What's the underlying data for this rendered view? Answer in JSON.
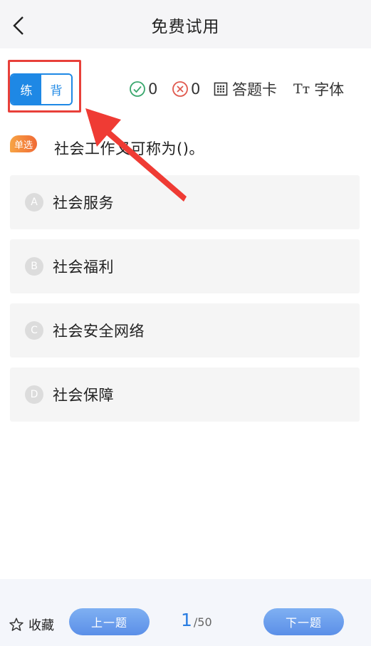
{
  "header": {
    "title": "免费试用",
    "back_icon": "chevron-left-icon"
  },
  "mode_toggle": {
    "practice_label": "练",
    "recite_label": "背",
    "active": "practice"
  },
  "stats": {
    "correct_count": "0",
    "wrong_count": "0"
  },
  "tools": {
    "answer_card_label": "答题卡",
    "font_label": "字体",
    "font_glyph": "Tт"
  },
  "question": {
    "type_label": "单选",
    "text": "社会工作又可称为()。"
  },
  "options": [
    {
      "letter": "A",
      "text": "社会服务"
    },
    {
      "letter": "B",
      "text": "社会福利"
    },
    {
      "letter": "C",
      "text": "社会安全网络"
    },
    {
      "letter": "D",
      "text": "社会保障"
    }
  ],
  "footer": {
    "favorite_label": "收藏",
    "prev_label": "上一题",
    "next_label": "下一题",
    "current_page": "1",
    "total_pages": "/50"
  },
  "colors": {
    "accent": "#1e88e5",
    "annotation": "#e8403a",
    "badge": "#f28b3c"
  }
}
